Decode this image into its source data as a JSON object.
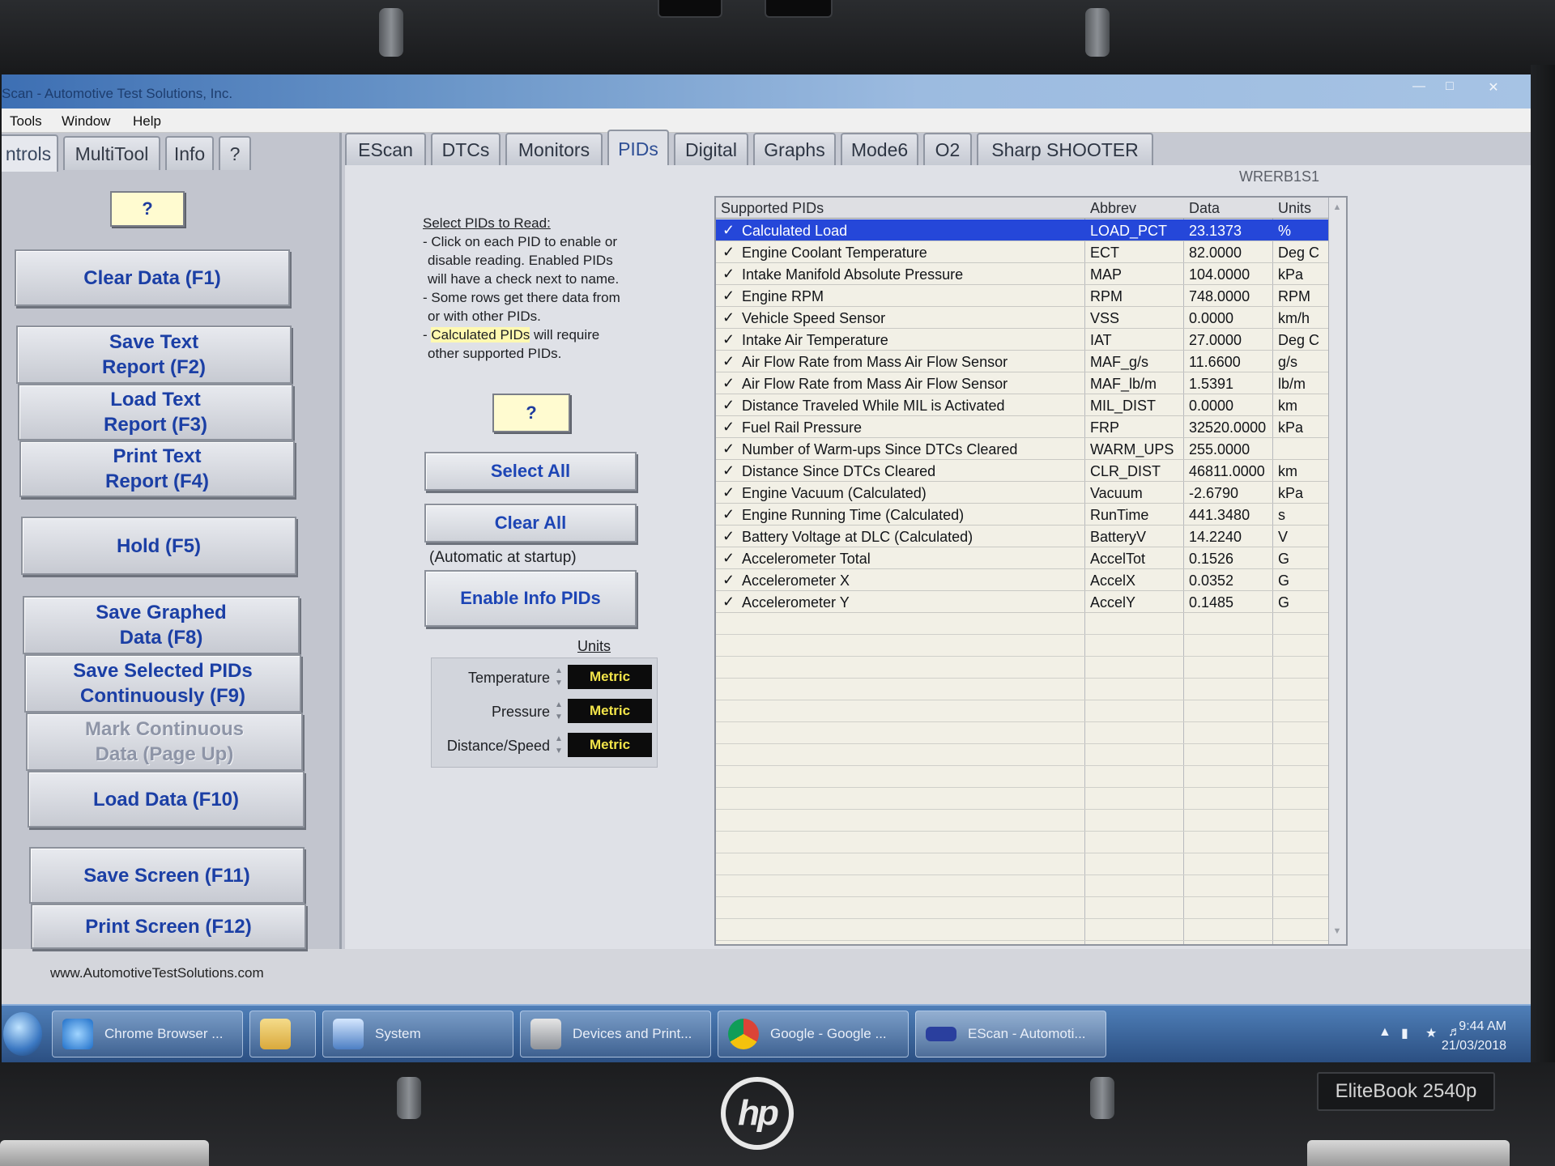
{
  "window": {
    "title": "Scan - Automotive Test Solutions, Inc.",
    "controls": [
      "minimize",
      "maximize",
      "close"
    ]
  },
  "menu": [
    "Tools",
    "Window",
    "Help"
  ],
  "left_tabs": [
    {
      "label": "ntrols",
      "active": true
    },
    {
      "label": "MultiTool",
      "active": false
    },
    {
      "label": "Info",
      "active": false
    },
    {
      "label": "?",
      "active": false
    }
  ],
  "left_panel": {
    "help_button": "?",
    "buttons": [
      {
        "label": "Clear Data (F1)",
        "disabled": false
      },
      {
        "label": "Save Text\nReport (F2)",
        "disabled": false
      },
      {
        "label": "Load Text\nReport (F3)",
        "disabled": false
      },
      {
        "label": "Print Text\nReport (F4)",
        "disabled": false
      },
      {
        "label": "Hold (F5)",
        "disabled": false
      },
      {
        "label": "Save Graphed\nData (F8)",
        "disabled": false
      },
      {
        "label": "Save Selected PIDs\nContinuously (F9)",
        "disabled": false
      },
      {
        "label": "Mark Continuous\nData (Page Up)",
        "disabled": true
      },
      {
        "label": "Load Data (F10)",
        "disabled": false
      },
      {
        "label": "Save Screen (F11)",
        "disabled": false
      },
      {
        "label": "Print Screen (F12)",
        "disabled": false
      }
    ],
    "site_url": "www.AutomotiveTestSolutions.com"
  },
  "main_tabs": [
    {
      "label": "EScan",
      "active": false
    },
    {
      "label": "DTCs",
      "active": false
    },
    {
      "label": "Monitors",
      "active": false
    },
    {
      "label": "PIDs",
      "active": true
    },
    {
      "label": "Digital",
      "active": false
    },
    {
      "label": "Graphs",
      "active": false
    },
    {
      "label": "Mode6",
      "active": false
    },
    {
      "label": "O2",
      "active": false
    },
    {
      "label": "Sharp SHOOTER",
      "active": false
    }
  ],
  "vin_label": "WRERB1S1",
  "instructions": {
    "header": "Select PIDs to Read:",
    "line1a": "- Click on each PID to enable or",
    "line1b": "disable reading.  Enabled PIDs",
    "line1c": "will have a check next to name.",
    "line2a": "- Some rows get there data from",
    "line2b": "or with other PIDs.",
    "line3_highlight": "Calculated PIDs",
    "line3_rest": " will require",
    "line3b": "other supported PIDs."
  },
  "pid_controls": {
    "help_button": "?",
    "select_all": "Select All",
    "clear_all": "Clear All",
    "auto_label": "(Automatic at startup)",
    "enable_info": "Enable Info PIDs",
    "units_title": "Units",
    "units": [
      {
        "name": "Temperature",
        "value": "Metric"
      },
      {
        "name": "Pressure",
        "value": "Metric"
      },
      {
        "name": "Distance/Speed",
        "value": "Metric"
      }
    ]
  },
  "grid": {
    "headers": {
      "name": "Supported PIDs",
      "abbrev": "Abbrev",
      "data": "Data",
      "units": "Units"
    },
    "check_glyph": "✓",
    "rows": [
      {
        "name": "Calculated Load",
        "abbrev": "LOAD_PCT",
        "data": "23.1373",
        "units": "%",
        "selected": true
      },
      {
        "name": "Engine Coolant Temperature",
        "abbrev": "ECT",
        "data": "82.0000",
        "units": "Deg C"
      },
      {
        "name": "Intake Manifold Absolute Pressure",
        "abbrev": "MAP",
        "data": "104.0000",
        "units": "kPa"
      },
      {
        "name": "Engine RPM",
        "abbrev": "RPM",
        "data": "748.0000",
        "units": "RPM"
      },
      {
        "name": "Vehicle Speed Sensor",
        "abbrev": "VSS",
        "data": "0.0000",
        "units": "km/h"
      },
      {
        "name": "Intake Air Temperature",
        "abbrev": "IAT",
        "data": "27.0000",
        "units": "Deg C"
      },
      {
        "name": "Air Flow Rate from Mass Air Flow Sensor",
        "abbrev": "MAF_g/s",
        "data": "11.6600",
        "units": "g/s"
      },
      {
        "name": "Air Flow Rate from Mass Air Flow Sensor",
        "abbrev": "MAF_lb/m",
        "data": "1.5391",
        "units": "lb/m"
      },
      {
        "name": "Distance Traveled While MIL is Activated",
        "abbrev": "MIL_DIST",
        "data": "0.0000",
        "units": "km"
      },
      {
        "name": "Fuel Rail Pressure",
        "abbrev": "FRP",
        "data": "32520.0000",
        "units": "kPa"
      },
      {
        "name": "Number of Warm-ups Since DTCs Cleared",
        "abbrev": "WARM_UPS",
        "data": "255.0000",
        "units": ""
      },
      {
        "name": "Distance Since DTCs Cleared",
        "abbrev": "CLR_DIST",
        "data": "46811.0000",
        "units": "km"
      },
      {
        "name": "Engine Vacuum (Calculated)",
        "abbrev": "Vacuum",
        "data": "-2.6790",
        "units": "kPa"
      },
      {
        "name": "Engine Running Time (Calculated)",
        "abbrev": "RunTime",
        "data": "441.3480",
        "units": "s"
      },
      {
        "name": "Battery Voltage at DLC (Calculated)",
        "abbrev": "BatteryV",
        "data": "14.2240",
        "units": "V"
      },
      {
        "name": "Accelerometer Total",
        "abbrev": "AccelTot",
        "data": "0.1526",
        "units": "G"
      },
      {
        "name": "Accelerometer X",
        "abbrev": "AccelX",
        "data": "0.0352",
        "units": "G"
      },
      {
        "name": "Accelerometer Y",
        "abbrev": "AccelY",
        "data": "0.1485",
        "units": "G"
      }
    ]
  },
  "taskbar": {
    "items": [
      "Chrome Browser ...",
      "",
      "System",
      "Devices and Print...",
      "Google - Google ...",
      "EScan - Automoti..."
    ],
    "time": "9:44 AM",
    "date": "21/03/2018"
  },
  "laptop": {
    "brand": "hp",
    "model": "EliteBook 2540p"
  }
}
